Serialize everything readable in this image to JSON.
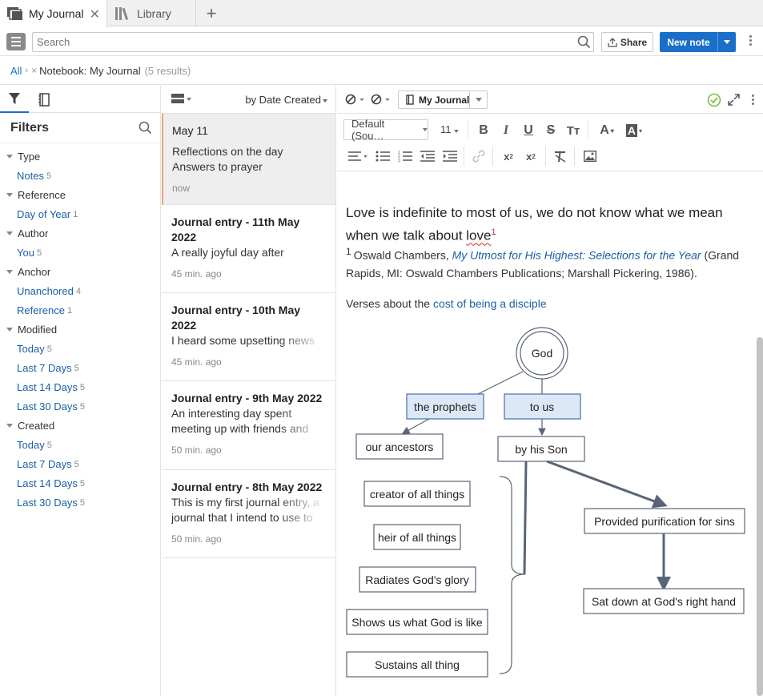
{
  "tabs": [
    {
      "label": "My Journal",
      "active": true
    },
    {
      "label": "Library",
      "active": false
    }
  ],
  "toolbar": {
    "search_placeholder": "Search",
    "share_label": "Share",
    "new_note_label": "New note"
  },
  "breadcrumb": {
    "all": "All",
    "notebook": "Notebook: My Journal",
    "count": "(5 results)"
  },
  "filters": {
    "title": "Filters",
    "groups": [
      {
        "title": "Type",
        "items": [
          {
            "label": "Notes",
            "count": "5"
          }
        ]
      },
      {
        "title": "Reference",
        "items": [
          {
            "label": "Day of Year",
            "count": "1"
          }
        ]
      },
      {
        "title": "Author",
        "items": [
          {
            "label": "You",
            "count": "5"
          }
        ]
      },
      {
        "title": "Anchor",
        "items": [
          {
            "label": "Unanchored",
            "count": "4"
          },
          {
            "label": "Reference",
            "count": "1"
          }
        ]
      },
      {
        "title": "Modified",
        "items": [
          {
            "label": "Today",
            "count": "5"
          },
          {
            "label": "Last 7 Days",
            "count": "5"
          },
          {
            "label": "Last 14 Days",
            "count": "5"
          },
          {
            "label": "Last 30 Days",
            "count": "5"
          }
        ]
      },
      {
        "title": "Created",
        "items": [
          {
            "label": "Today",
            "count": "5"
          },
          {
            "label": "Last 7 Days",
            "count": "5"
          },
          {
            "label": "Last 14 Days",
            "count": "5"
          },
          {
            "label": "Last 30 Days",
            "count": "5"
          }
        ]
      }
    ]
  },
  "list": {
    "sort_label": "by Date Created",
    "notes": [
      {
        "title": "May 11",
        "lines": [
          "Reflections on the day",
          "Answers to prayer"
        ],
        "time": "now",
        "selected": true
      },
      {
        "title": "Journal entry - 11th May 2022",
        "lines": [
          "A really joyful day after"
        ],
        "time": "45 min. ago",
        "selected": false
      },
      {
        "title": "Journal entry - 10th May 2022",
        "lines": [
          "I heard some upsetting news"
        ],
        "time": "45 min. ago",
        "selected": false
      },
      {
        "title": "Journal entry - 9th May 2022",
        "lines": [
          "An interesting day spent",
          "meeting up with friends and"
        ],
        "time": "50 min. ago",
        "selected": false
      },
      {
        "title": "Journal entry - 8th May 2022",
        "lines": [
          "This is my first journal entry, a",
          "journal that I intend to use to"
        ],
        "time": "50 min. ago",
        "selected": false
      }
    ]
  },
  "editor": {
    "notebook_label": "My Journal",
    "font_label": "Default (Sou…",
    "size_label": "11",
    "line1_text": "Love is indefinite to most of us, we do not know what we mean when we talk about ",
    "line1_word": "love",
    "footnote_ref": "1",
    "footnote_num": "1",
    "footnote_author": "Oswald Chambers, ",
    "footnote_book": "My Utmost for His Highest: Selections for the Year",
    "footnote_rest": " (Grand Rapids, MI: Oswald Chambers Publications; Marshall Pickering, 1986).",
    "verses_prefix": "Verses about the ",
    "verses_link": "cost of being a disciple"
  },
  "diagram": {
    "nodes": {
      "god": "God",
      "prophets": "the prophets",
      "to_us": "to us",
      "ancestors": "our ancestors",
      "son": "by his Son",
      "creator": "creator of all things",
      "heir": "heir of all things",
      "radiates": "Radiates God's glory",
      "shows": "Shows us what God is like",
      "sustains": "Sustains all thing",
      "purification": "Provided purification for sins",
      "sat_down": "Sat down at God's right hand"
    },
    "colors": {
      "highlight_fill": "#dce8f8",
      "highlight_stroke": "#4a6fa5",
      "box_stroke": "#5a6478",
      "arrow": "#5a6478"
    }
  },
  "colors": {
    "accent": "#1a6fc9",
    "link": "#1a5fa8",
    "selected_marker": "#f0a070"
  }
}
